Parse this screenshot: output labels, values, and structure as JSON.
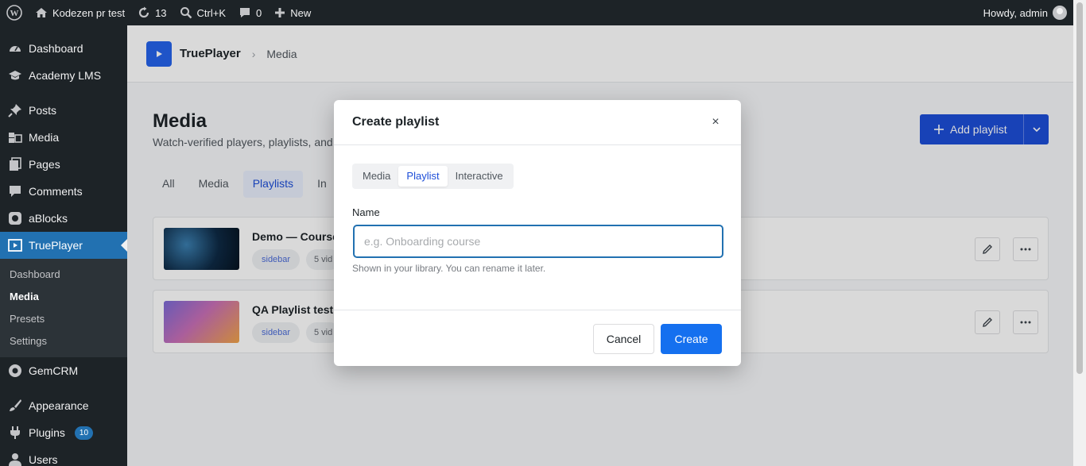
{
  "adminbar": {
    "site_name": "Kodezen pr test",
    "updates_count": "13",
    "search_shortcut": "Ctrl+K",
    "comments_count": "0",
    "new_label": "New",
    "greeting": "Howdy, admin"
  },
  "sidebar": {
    "items": [
      {
        "label": "Dashboard",
        "icon": "dashboard-icon"
      },
      {
        "label": "Academy LMS",
        "icon": "academy-icon"
      },
      {
        "label": "Posts",
        "icon": "pin-icon"
      },
      {
        "label": "Media",
        "icon": "media-icon"
      },
      {
        "label": "Pages",
        "icon": "pages-icon"
      },
      {
        "label": "Comments",
        "icon": "comment-icon"
      },
      {
        "label": "aBlocks",
        "icon": "ablocks-icon"
      },
      {
        "label": "TruePlayer",
        "icon": "player-icon"
      },
      {
        "label": "GemCRM",
        "icon": "gem-icon"
      },
      {
        "label": "Appearance",
        "icon": "brush-icon"
      },
      {
        "label": "Plugins",
        "icon": "plugin-icon",
        "badge": "10"
      },
      {
        "label": "Users",
        "icon": "user-icon"
      }
    ],
    "submenu": [
      "Dashboard",
      "Media",
      "Presets",
      "Settings"
    ]
  },
  "header": {
    "brand": "TruePlayer",
    "breadcrumb": "Media"
  },
  "page": {
    "title": "Media",
    "subtitle": "Watch-verified players, playlists, and",
    "add_button": "Add playlist",
    "tabs": [
      "All",
      "Media",
      "Playlists",
      "In"
    ]
  },
  "cards": [
    {
      "title": "Demo — Course",
      "chip": "sidebar",
      "meta": "5 vid"
    },
    {
      "title": "QA Playlist test",
      "chip": "sidebar",
      "meta": "5 vid"
    }
  ],
  "modal": {
    "title": "Create playlist",
    "close": "×",
    "segments": [
      "Media",
      "Playlist",
      "Interactive"
    ],
    "active_segment": "Playlist",
    "field_label": "Name",
    "field_placeholder": "e.g. Onboarding course",
    "field_value": "",
    "help_text": "Shown in your library. You can rename it later.",
    "cancel_label": "Cancel",
    "create_label": "Create"
  },
  "colors": {
    "accent": "#1570ef",
    "admin_dark": "#1d2327",
    "wp_blue": "#2271b1"
  }
}
